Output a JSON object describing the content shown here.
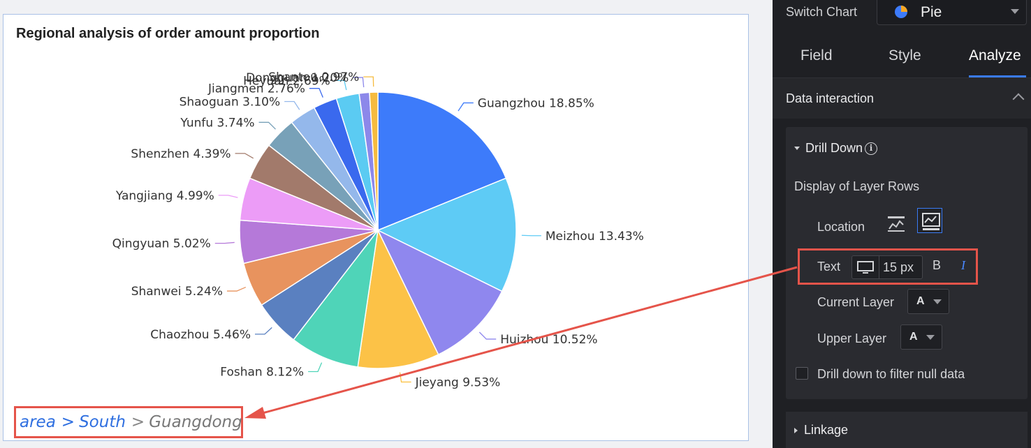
{
  "chart": {
    "title": "Regional analysis of order amount proportion",
    "breadcrumb": {
      "root": "area",
      "level1": "South",
      "current": "Guangdong",
      "separator": ">"
    }
  },
  "chart_data": {
    "type": "pie",
    "title": "Regional analysis of order amount proportion",
    "slices": [
      {
        "label": "Guangzhou",
        "value": 18.85,
        "display": "Guangzhou 18.85%",
        "color": "#3d7bfa"
      },
      {
        "label": "Meizhou",
        "value": 13.43,
        "display": "Meizhou 13.43%",
        "color": "#5ecbf5"
      },
      {
        "label": "Huizhou",
        "value": 10.52,
        "display": "Huizhou 10.52%",
        "color": "#8f87ee"
      },
      {
        "label": "Jieyang",
        "value": 9.53,
        "display": "Jieyang 9.53%",
        "color": "#fcc247"
      },
      {
        "label": "Foshan",
        "value": 8.12,
        "display": "Foshan 8.12%",
        "color": "#4fd4b8"
      },
      {
        "label": "Chaozhou",
        "value": 5.46,
        "display": "Chaozhou 5.46%",
        "color": "#5a80c0"
      },
      {
        "label": "Shanwei",
        "value": 5.24,
        "display": "Shanwei 5.24%",
        "color": "#e8935e"
      },
      {
        "label": "Qingyuan",
        "value": 5.02,
        "display": "Qingyuan 5.02%",
        "color": "#b579d9"
      },
      {
        "label": "Yangjiang",
        "value": 4.99,
        "display": "Yangjiang 4.99%",
        "color": "#ec9cf7"
      },
      {
        "label": "Shenzhen",
        "value": 4.39,
        "display": "Shenzhen 4.39%",
        "color": "#a27a6b"
      },
      {
        "label": "Yunfu",
        "value": 3.74,
        "display": "Yunfu 3.74%",
        "color": "#78a1b8"
      },
      {
        "label": "Shaoguan",
        "value": 3.1,
        "display": "Shaoguan 3.10%",
        "color": "#94b8eb"
      },
      {
        "label": "Jiangmen",
        "value": 2.76,
        "display": "Jiangmen 2.76%",
        "color": "#3a69ee"
      },
      {
        "label": "Heyuan",
        "value": 2.69,
        "display": "Heyuan 2.69%",
        "color": "#5bcbf2"
      },
      {
        "label": "Dongguan",
        "value": 1.2,
        "display": "Dongguan 1.20%",
        "color": "#8c88ea"
      },
      {
        "label": "Shantou",
        "value": 0.97,
        "display": "Shantou 0.97%",
        "color": "#f6bb3f"
      }
    ]
  },
  "panel": {
    "switch_label": "Switch Chart",
    "switch_value": "Pie",
    "tabs": [
      "Field",
      "Style",
      "Analyze"
    ],
    "active_tab": "Analyze",
    "section_title": "Data interaction",
    "drill_down": "Drill Down",
    "info_glyph": "i",
    "display_rows": "Display of Layer Rows",
    "location_label": "Location",
    "text_label": "Text",
    "font_size": "15 px",
    "bold_label": "B",
    "italic_label": "I",
    "current_layer_label": "Current Layer",
    "current_layer_value": "A",
    "upper_layer_label": "Upper Layer",
    "upper_layer_value": "A",
    "filter_null_label": "Drill down to filter null data",
    "linkage_label": "Linkage"
  },
  "colors": {
    "accent": "#3a7bf5",
    "highlight": "#e5544a",
    "panel_bg": "#1f2024"
  }
}
